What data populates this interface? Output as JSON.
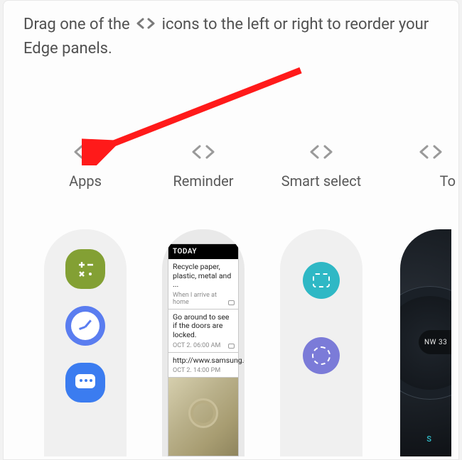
{
  "instructions": {
    "part1": "Drag one of the",
    "part2": "icons to the left or right to reorder your Edge panels."
  },
  "panels": [
    {
      "label": "Apps"
    },
    {
      "label": "Reminder"
    },
    {
      "label": "Smart select"
    },
    {
      "label": "To"
    }
  ],
  "reminder": {
    "header": "TODAY",
    "items": [
      {
        "title": "Recycle paper, plastic, metal and ...",
        "sub": "When I arrive at home"
      },
      {
        "title": "Go around to see if the doors are locked.",
        "sub": "OCT 2. 06:00 AM"
      },
      {
        "title": "http://www.samsung.com",
        "sub": "OCT 2. 14:00 PM"
      }
    ]
  },
  "compass": {
    "direction": "NW 33",
    "south_label": "S"
  },
  "calc_glyphs": "+ −\n× ·"
}
